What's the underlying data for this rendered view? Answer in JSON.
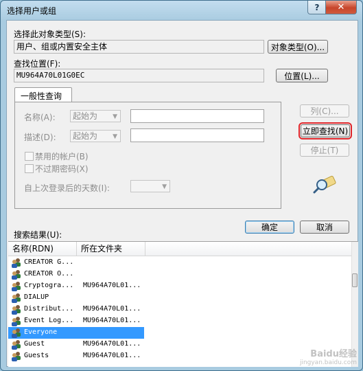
{
  "window": {
    "title": "选择用户或组",
    "help_glyph": "?",
    "close_glyph": "✕"
  },
  "object_type": {
    "label": "选择此对象类型(S):",
    "value": "用户、组或内置安全主体",
    "button": "对象类型(O)..."
  },
  "location": {
    "label": "查找位置(F):",
    "value": "MU964A70L01G0EC",
    "button": "位置(L)..."
  },
  "tab": {
    "label": "一般性查询"
  },
  "query": {
    "name_label": "名称(A):",
    "name_mode": "起始为",
    "desc_label": "描述(D):",
    "desc_mode": "起始为",
    "disabled_accounts": "禁用的帐户(B)",
    "non_expiring_pw": "不过期密码(X)",
    "days_label": "自上次登录后的天数(I):"
  },
  "actions": {
    "columns": "列(C)...",
    "find_now": "立即查找(N)",
    "stop": "停止(T)",
    "ok": "确定",
    "cancel": "取消"
  },
  "results": {
    "label": "搜索结果(U):",
    "columns": [
      "名称(RDN)",
      "所在文件夹"
    ],
    "rows": [
      {
        "name": "CREATOR G...",
        "folder": ""
      },
      {
        "name": "CREATOR O...",
        "folder": ""
      },
      {
        "name": "Cryptogra...",
        "folder": "MU964A70L01..."
      },
      {
        "name": "DIALUP",
        "folder": ""
      },
      {
        "name": "Distribut...",
        "folder": "MU964A70L01..."
      },
      {
        "name": "Event Log...",
        "folder": "MU964A70L01..."
      },
      {
        "name": "Everyone",
        "folder": ""
      },
      {
        "name": "Guest",
        "folder": "MU964A70L01..."
      },
      {
        "name": "Guests",
        "folder": "MU964A70L01..."
      }
    ],
    "selected_index": 6
  },
  "watermark": {
    "line1": "Baidu经验",
    "line2": "jingyan.baidu.com"
  },
  "colors": {
    "selection": "#3399ff",
    "focus_outline": "#e0262b",
    "title_bar": "#a8cbe0"
  },
  "icons": {
    "find": "magnifier-icon",
    "user_group": "users-icon"
  }
}
